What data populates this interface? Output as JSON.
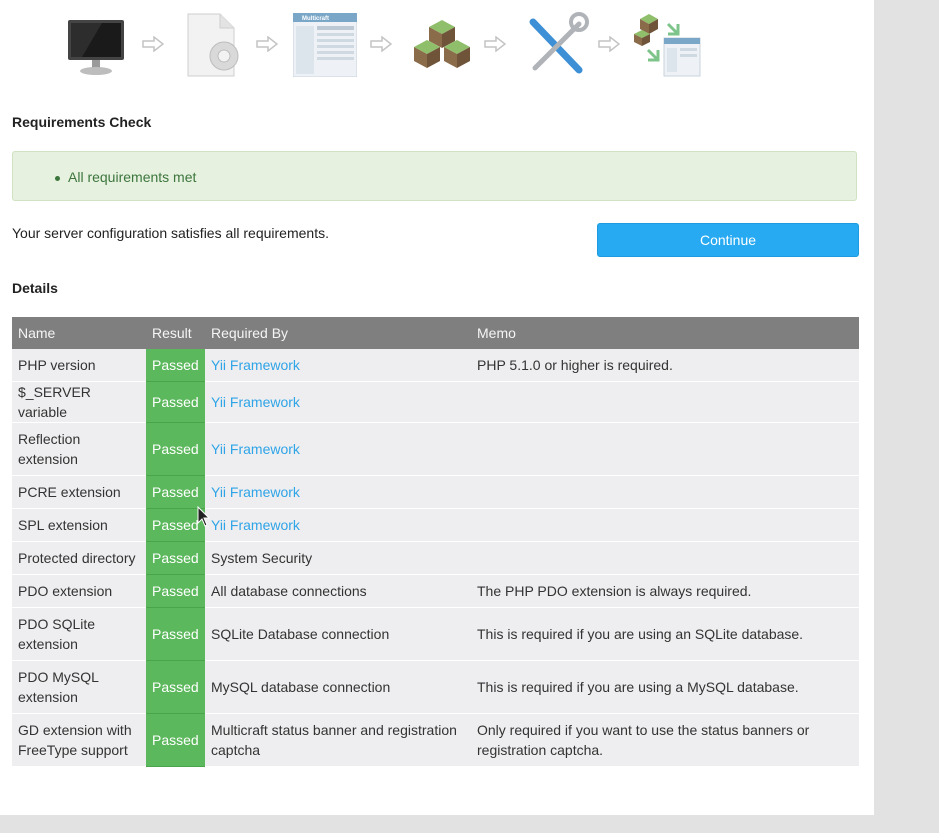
{
  "steps": [
    {
      "icon": "monitor-icon"
    },
    {
      "icon": "document-gear-icon"
    },
    {
      "icon": "multicraft-screenshot-icon",
      "text": "Multicraft"
    },
    {
      "icon": "minecraft-blocks-icon"
    },
    {
      "icon": "tools-icon"
    },
    {
      "icon": "blocks-transfer-icon"
    }
  ],
  "requirements_title": "Requirements Check",
  "alert": {
    "message": "All requirements met"
  },
  "summary": "Your server configuration satisfies all requirements.",
  "continue_label": "Continue",
  "details_title": "Details",
  "table": {
    "headers": {
      "name": "Name",
      "result": "Result",
      "required_by": "Required By",
      "memo": "Memo"
    },
    "rows": [
      {
        "name": "PHP version",
        "result": "Passed",
        "required_by": "Yii Framework",
        "memo": "PHP 5.1.0 or higher is required."
      },
      {
        "name": "$_SERVER variable",
        "result": "Passed",
        "required_by": "Yii Framework",
        "memo": ""
      },
      {
        "name": "Reflection extension",
        "result": "Passed",
        "required_by": "Yii Framework",
        "memo": ""
      },
      {
        "name": "PCRE extension",
        "result": "Passed",
        "required_by": "Yii Framework",
        "memo": ""
      },
      {
        "name": "SPL extension",
        "result": "Passed",
        "required_by": "Yii Framework",
        "memo": ""
      },
      {
        "name": "Protected directory",
        "result": "Passed",
        "required_by": "System Security",
        "memo": ""
      },
      {
        "name": "PDO extension",
        "result": "Passed",
        "required_by": "All database connections",
        "memo": "The PHP PDO extension is always required."
      },
      {
        "name": "PDO SQLite extension",
        "result": "Passed",
        "required_by": "SQLite Database connection",
        "memo": "This is required if you are using an SQLite database."
      },
      {
        "name": "PDO MySQL extension",
        "result": "Passed",
        "required_by": "MySQL database connection",
        "memo": "This is required if you are using a MySQL database."
      },
      {
        "name": "GD extension with FreeType support",
        "result": "Passed",
        "required_by": "Multicraft status banner and registration captcha",
        "memo": "Only required if you want to use the status banners or registration captcha."
      }
    ]
  },
  "colors": {
    "accent": "#27aaf2",
    "pass": "#5cb85c",
    "link": "#2fa4e7",
    "alert_bg": "#e6f1df",
    "alert_text": "#3c763d",
    "header_bg": "#7f7f7f"
  }
}
